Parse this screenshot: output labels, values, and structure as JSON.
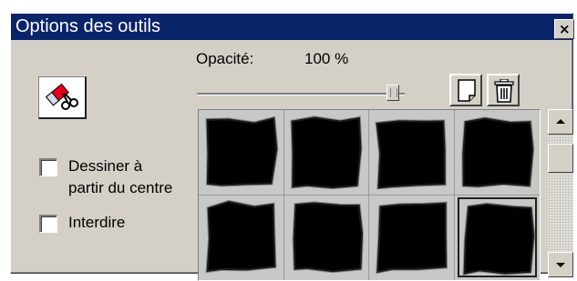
{
  "window": {
    "title": "Options des outils",
    "close_glyph": "×"
  },
  "tool": {
    "icon": "eraser-scissors-icon"
  },
  "opacity": {
    "label": "Opacité:",
    "value_text": "100 %",
    "value": 100
  },
  "options": {
    "draw_from_center": {
      "line1": "Dessiner à",
      "line2": "partir du centre",
      "checked": false
    },
    "forbid": {
      "label": "Interdire",
      "checked": false
    }
  },
  "toolbar": {
    "new_icon": "new-page-icon",
    "delete_icon": "trash-icon"
  },
  "brushes": {
    "count": 8,
    "columns": 4,
    "selected_index": 7,
    "icon": "brush-preset-icon"
  },
  "colors": {
    "title_bar": "#0a246a",
    "face": "#d4d0c8",
    "brush": "#000000"
  }
}
